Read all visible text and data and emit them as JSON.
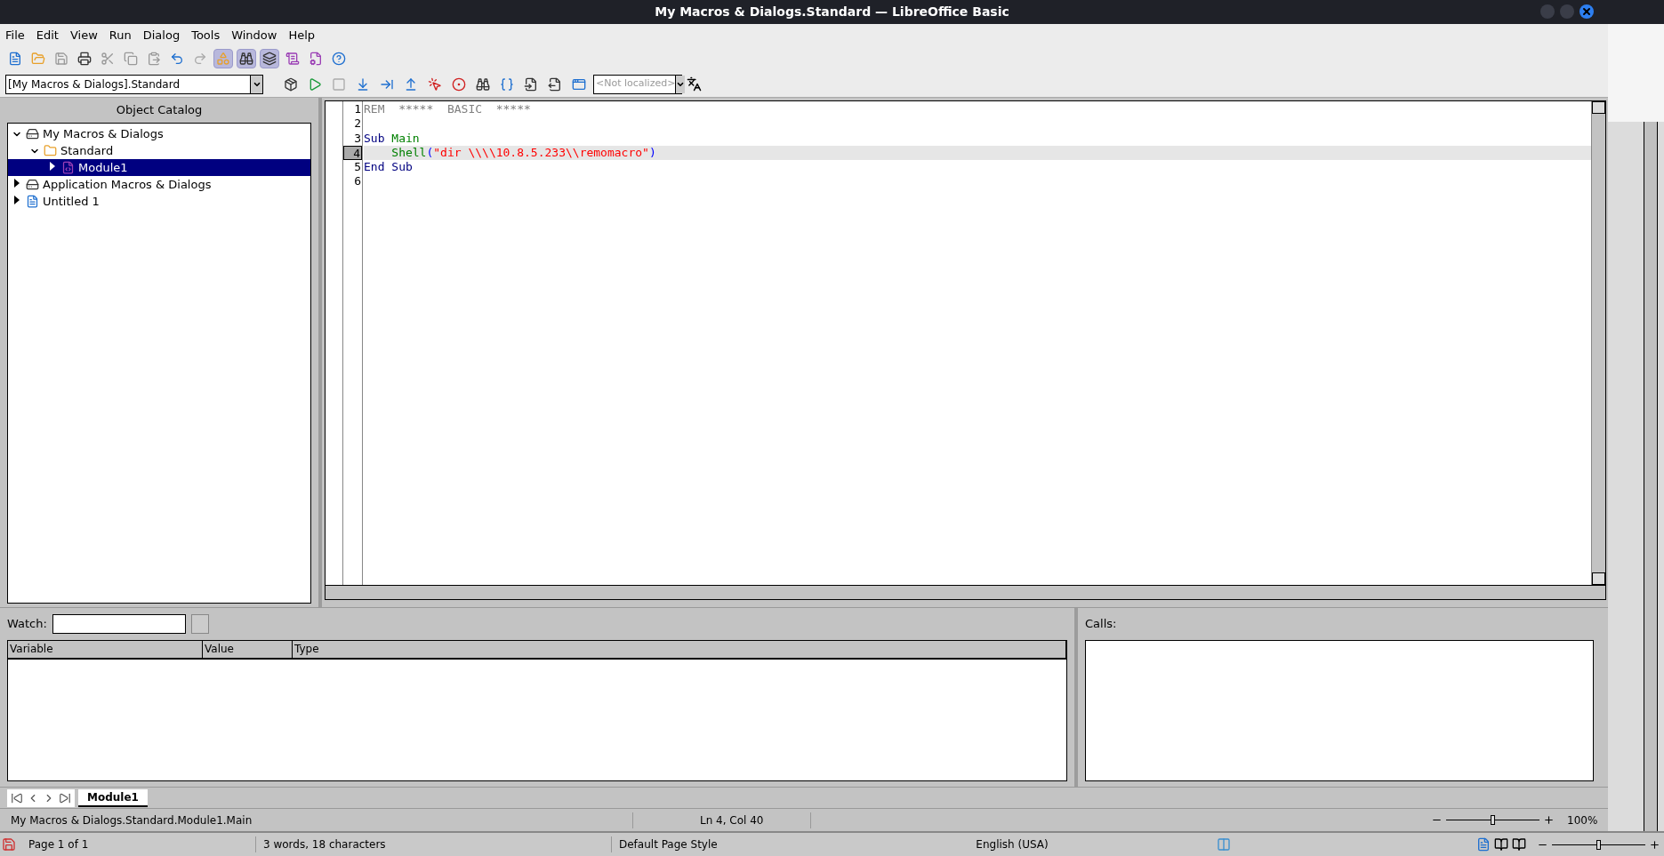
{
  "window": {
    "title": "My Macros & Dialogs.Standard — LibreOffice Basic"
  },
  "menu": [
    "File",
    "Edit",
    "View",
    "Run",
    "Dialog",
    "Tools",
    "Window",
    "Help"
  ],
  "toolbar": [
    {
      "kind": "new",
      "selected": false
    },
    {
      "kind": "open",
      "selected": false
    },
    {
      "kind": "save",
      "selected": false
    },
    {
      "kind": "print",
      "selected": false
    },
    {
      "kind": "cut",
      "selected": false
    },
    {
      "kind": "copy",
      "selected": false
    },
    {
      "kind": "paste",
      "selected": false
    },
    {
      "kind": "undo",
      "selected": false
    },
    {
      "kind": "redo",
      "selected": false
    },
    {
      "kind": "catalog",
      "selected": true
    },
    {
      "kind": "watch",
      "selected": true
    },
    {
      "kind": "stack",
      "selected": true
    },
    {
      "kind": "macro",
      "selected": false
    },
    {
      "kind": "organize",
      "selected": false
    },
    {
      "kind": "help",
      "selected": false
    }
  ],
  "library_select": {
    "value": "[My Macros & Dialogs].Standard"
  },
  "macro_toolbar": [
    {
      "kind": "compile"
    },
    {
      "kind": "run"
    },
    {
      "kind": "stop"
    },
    {
      "kind": "step_into"
    },
    {
      "kind": "step_over"
    },
    {
      "kind": "step_out"
    },
    {
      "kind": "breakpoint"
    },
    {
      "kind": "manage_breakpoints"
    },
    {
      "kind": "find"
    },
    {
      "kind": "brackets"
    },
    {
      "kind": "import"
    },
    {
      "kind": "export"
    },
    {
      "kind": "dialog"
    }
  ],
  "language_select": {
    "placeholder": "<Not localized>"
  },
  "object_catalog": {
    "title": "Object Catalog",
    "tree": [
      {
        "label": "My Macros & Dialogs",
        "kind": "library",
        "expanded": true,
        "selected": false,
        "children": [
          {
            "label": "Standard",
            "kind": "folder",
            "expanded": true,
            "selected": false,
            "children": [
              {
                "label": "Module1",
                "kind": "module",
                "expanded": false,
                "selected": true
              }
            ]
          }
        ]
      },
      {
        "label": "Application Macros & Dialogs",
        "kind": "library",
        "expanded": false,
        "selected": false
      },
      {
        "label": "Untitled 1",
        "kind": "document",
        "expanded": false,
        "selected": false
      }
    ]
  },
  "editor": {
    "lines": [
      {
        "number": "1",
        "current": false,
        "tokens": [
          {
            "kind": "comment",
            "text": "REM  *****  BASIC  *****"
          }
        ]
      },
      {
        "number": "2",
        "current": false
      },
      {
        "number": "3",
        "current": false,
        "tokens": [
          {
            "kind": "keyword",
            "text": "Sub"
          },
          {
            "kind": "identifier",
            "text": " Main"
          }
        ]
      },
      {
        "number": "4",
        "current": true,
        "tokens": [
          {
            "kind": "identifier",
            "text": "    Shell"
          },
          {
            "kind": "operator",
            "text": "("
          },
          {
            "kind": "string",
            "text": "\"dir \\\\\\\\10.8.5.233\\\\remomacro\""
          },
          {
            "kind": "operator",
            "text": ")"
          }
        ]
      },
      {
        "number": "5",
        "current": false,
        "tokens": [
          {
            "kind": "keyword",
            "text": "End"
          },
          {
            "kind": "keyword",
            "text": " Sub"
          }
        ]
      },
      {
        "number": "6",
        "current": false
      }
    ]
  },
  "watch": {
    "label": "Watch:",
    "columns": [
      "Variable",
      "Value",
      "Type"
    ]
  },
  "calls": {
    "label": "Calls:"
  },
  "module_tabs": [
    {
      "label": "Module1",
      "selected": true
    }
  ],
  "status_bar": {
    "path": "My Macros & Dialogs.Standard.Module1.Main",
    "position": "Ln 4, Col 40",
    "zoom_slider": {
      "level": 0.5
    },
    "zoom": "100%"
  },
  "document_status_bar": {
    "page": "Page 1 of 1",
    "words": "3 words, 18 characters",
    "page_style": "Default Page Style",
    "language": "English (USA)",
    "zoom_slider": {
      "level": 0.5
    }
  }
}
